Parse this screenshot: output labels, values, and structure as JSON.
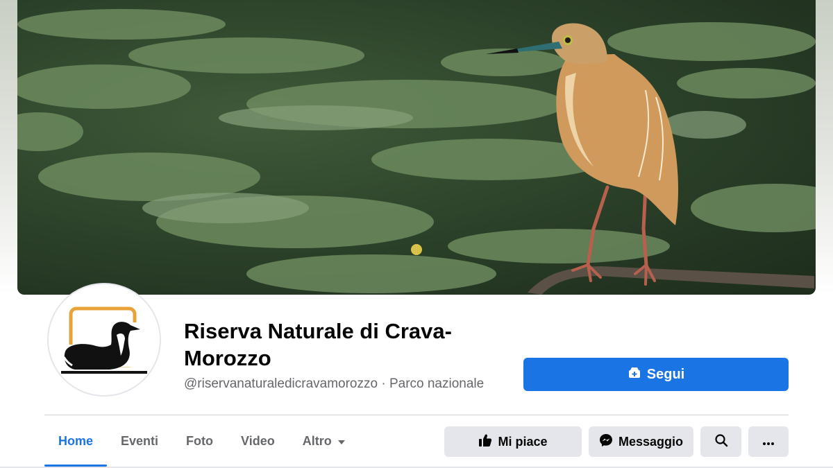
{
  "page": {
    "name": "Riserva Naturale di Crava-Morozzo",
    "handle": "@riservanaturaledicravamorozzo",
    "separator": "·",
    "category": "Parco nazionale"
  },
  "cover": {
    "subject": "Squacco heron perched on a branch above a pond with water lilies"
  },
  "follow_button": {
    "label": "Segui",
    "icon": "follow-plus-icon",
    "color": "#1b74e4"
  },
  "tabs": [
    {
      "label": "Home",
      "active": true
    },
    {
      "label": "Eventi",
      "active": false
    },
    {
      "label": "Foto",
      "active": false
    },
    {
      "label": "Video",
      "active": false
    },
    {
      "label": "Altro",
      "active": false,
      "icon": "caret-down-icon"
    }
  ],
  "actions": {
    "like_label": "Mi piace",
    "like_icon": "thumbs-up-icon",
    "message_label": "Messaggio",
    "message_icon": "messenger-icon",
    "search_icon": "search-icon",
    "more_icon": "more-dots-icon"
  },
  "colors": {
    "accent": "#1b74e4",
    "secondary_text": "#65676b",
    "button_bg": "#e4e6eb",
    "logo_orange": "#e8a23a"
  }
}
